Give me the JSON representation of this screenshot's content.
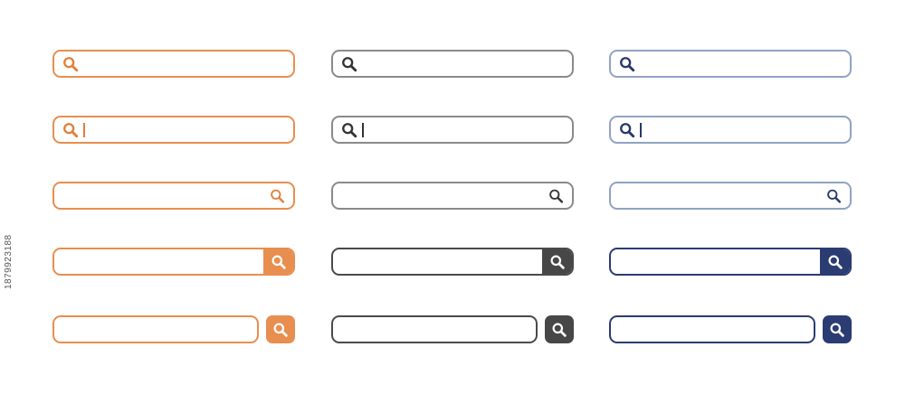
{
  "styles": [
    {
      "name": "orange",
      "border": "#E88E4F",
      "icon": "#E0803C",
      "button": "#E88E4F",
      "caret": "#E0803C"
    },
    {
      "name": "gray",
      "border": "#8A8A8A",
      "icon": "#333333",
      "button": "#474747",
      "strong_border": "#4A4A4A",
      "caret": "#333333"
    },
    {
      "name": "blue",
      "border": "#8FA3C4",
      "icon": "#27386B",
      "button": "#2B3C73",
      "strong_border": "#2B3C73",
      "caret": "#27386B"
    }
  ],
  "variants": [
    {
      "id": "icon-left",
      "icon": "search-icon",
      "placeholder": ""
    },
    {
      "id": "icon-left-with-caret",
      "icon": "search-icon",
      "placeholder": ""
    },
    {
      "id": "icon-right",
      "icon": "search-icon",
      "placeholder": ""
    },
    {
      "id": "attached-button",
      "icon": "search-icon",
      "placeholder": ""
    },
    {
      "id": "detached-button",
      "icon": "search-icon",
      "placeholder": ""
    }
  ],
  "stock_id": "1879923188"
}
